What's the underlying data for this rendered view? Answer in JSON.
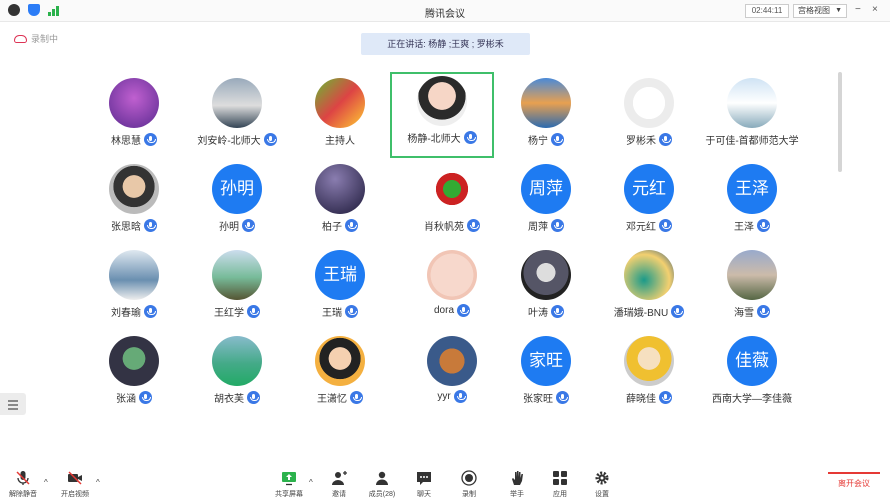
{
  "window": {
    "title": "腾讯会议",
    "meeting_time": "02:44:11",
    "view_mode": "宫格视图"
  },
  "recording": {
    "label": "录制中"
  },
  "speaking": {
    "text": "正在讲话: 杨静 ;王爽 ; 罗彬禾"
  },
  "participants": [
    {
      "name": "林思慧",
      "initials": "",
      "mic": true
    },
    {
      "name": "刘安岭-北师大",
      "initials": "",
      "mic": true
    },
    {
      "name": "主持人",
      "initials": "",
      "mic": false
    },
    {
      "name": "杨静-北师大",
      "initials": "",
      "mic": true,
      "active": true
    },
    {
      "name": "杨宁",
      "initials": "",
      "mic": true
    },
    {
      "name": "罗彬禾",
      "initials": "",
      "mic": true
    },
    {
      "name": "于可佳-首都师范大学",
      "initials": "",
      "mic": false
    },
    {
      "name": "张思晗",
      "initials": "",
      "mic": true
    },
    {
      "name": "孙明",
      "initials": "孙明",
      "mic": true
    },
    {
      "name": "柏子",
      "initials": "",
      "mic": true
    },
    {
      "name": "肖秋帆苑",
      "initials": "",
      "mic": true
    },
    {
      "name": "周萍",
      "initials": "周萍",
      "mic": true
    },
    {
      "name": "邓元红",
      "initials": "元红",
      "mic": true
    },
    {
      "name": "王泽",
      "initials": "王泽",
      "mic": true
    },
    {
      "name": "刘春瑜",
      "initials": "",
      "mic": true
    },
    {
      "name": "王红学",
      "initials": "",
      "mic": true
    },
    {
      "name": "王瑞",
      "initials": "王瑞",
      "mic": true
    },
    {
      "name": "dora",
      "initials": "",
      "mic": true
    },
    {
      "name": "叶涛",
      "initials": "",
      "mic": true
    },
    {
      "name": "潘瑞娥-BNU",
      "initials": "",
      "mic": true
    },
    {
      "name": "海雪",
      "initials": "",
      "mic": true
    },
    {
      "name": "张涵",
      "initials": "",
      "mic": true
    },
    {
      "name": "胡衣芙",
      "initials": "",
      "mic": true
    },
    {
      "name": "王潇忆",
      "initials": "",
      "mic": true
    },
    {
      "name": "yyr",
      "initials": "",
      "mic": true
    },
    {
      "name": "张家旺",
      "initials": "家旺",
      "mic": true
    },
    {
      "name": "薛晓佳",
      "initials": "",
      "mic": true
    },
    {
      "name": "西南大学—李佳薇",
      "initials": "佳薇",
      "mic": false
    }
  ],
  "toolbar": {
    "mute_label": "解除静音",
    "video_label": "开启视频",
    "share_label": "共享屏幕",
    "invite_label": "邀请",
    "members_label": "成员(28)",
    "chat_label": "聊天",
    "record_label": "录制",
    "hand_label": "举手",
    "apps_label": "应用",
    "settings_label": "设置",
    "end_label": "离开会议"
  },
  "colors": {
    "accent_blue": "#1e7bf2",
    "active_border": "#3fbf6a",
    "end_red": "#e53935"
  }
}
